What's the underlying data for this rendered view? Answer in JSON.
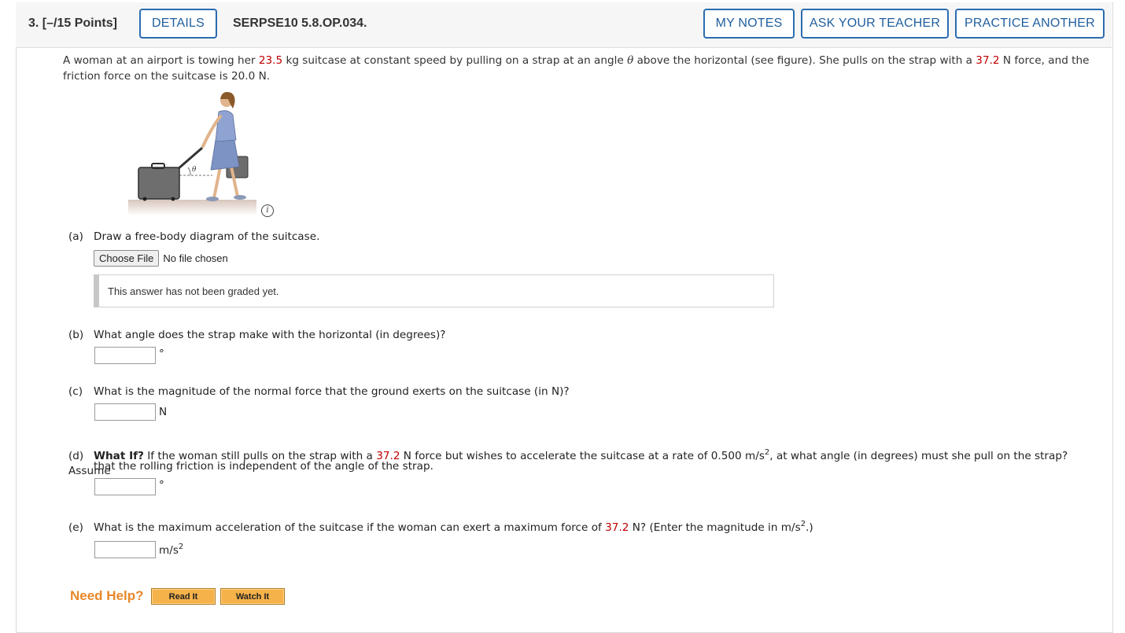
{
  "question": {
    "number_points": "3. [–/15 Points]",
    "details_label": "DETAILS",
    "code": "SERPSE10 5.8.OP.034.",
    "my_notes_label": "MY NOTES",
    "ask_teacher_label": "ASK YOUR TEACHER",
    "practice_label": "PRACTICE ANOTHER"
  },
  "problem": {
    "t1": "A woman at an airport is towing her ",
    "mass": "23.5",
    "t2": " kg suitcase at constant speed by pulling on a strap at an angle ",
    "theta": "θ",
    "t3": " above the horizontal (see figure). She pulls on the strap with a ",
    "force": "37.2",
    "t4": " N force, and the friction force on the suitcase is 20.0 N."
  },
  "figure": {
    "angle_symbol": "θ",
    "info_icon": "i"
  },
  "parts": {
    "a": {
      "label": "(a)",
      "question": "Draw a free-body diagram of the suitcase.",
      "file_button": "Choose File",
      "file_status": "No file chosen",
      "graded_text": "This answer has not been graded yet."
    },
    "b": {
      "label": "(b)",
      "question": "What angle does the strap make with the horizontal (in degrees)?",
      "unit": "°"
    },
    "c": {
      "label": "(c)",
      "question": "What is the magnitude of the normal force that the ground exerts on the suitcase (in N)?",
      "unit": "N"
    },
    "d": {
      "label": "(d)",
      "bold": "What If?",
      "t1": " If the woman still pulls on the strap with a ",
      "force": "37.2",
      "t2": " N force but wishes to accelerate the suitcase at a rate of 0.500 m/s",
      "sup": "2",
      "t3": ", at what angle (in degrees) must she pull on the strap? Assume",
      "t4": "that the rolling friction is independent of the angle of the strap.",
      "unit": "°"
    },
    "e": {
      "label": "(e)",
      "t1": "What is the maximum acceleration of the suitcase if the woman can exert a maximum force of ",
      "force": "37.2",
      "t2": " N? (Enter the magnitude in m/s",
      "sup": "2",
      "t3": ".)",
      "unit": "m/s",
      "unit_sup": "2"
    }
  },
  "help": {
    "label": "Need Help?",
    "read_it": "Read It",
    "watch_it": "Watch It"
  },
  "colors": {
    "accent_blue": "#1f5f9e",
    "highlight_red": "#c00000",
    "help_orange": "#e8882b",
    "help_button": "#f6b24a"
  }
}
